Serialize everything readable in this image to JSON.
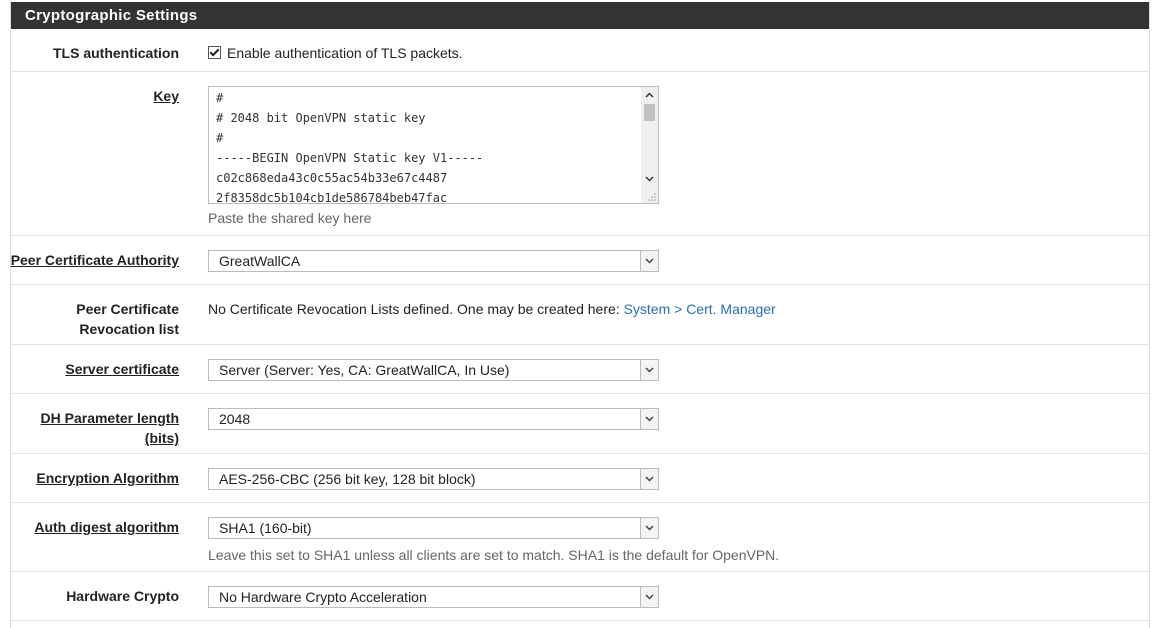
{
  "section": {
    "title": "Cryptographic Settings"
  },
  "tls": {
    "label": "TLS authentication",
    "checkbox_label": "Enable authentication of TLS packets.",
    "checked": true
  },
  "key": {
    "label": "Key",
    "lines": [
      "#",
      "# 2048 bit OpenVPN static key",
      "#",
      "-----BEGIN OpenVPN Static key V1-----",
      "c02c868eda43c0c55ac54b33e67c4487",
      "2f8358dc5b104cb1de586784beb47fac"
    ],
    "help": "Paste the shared key here"
  },
  "peer_ca": {
    "label": "Peer Certificate Authority",
    "value": "GreatWallCA"
  },
  "peer_crl": {
    "label_line1": "Peer Certificate",
    "label_line2": "Revocation list",
    "text": "No Certificate Revocation Lists defined. One may be created here:",
    "link": "System > Cert. Manager"
  },
  "server_cert": {
    "label": "Server certificate",
    "value": "Server (Server: Yes, CA: GreatWallCA, In Use)"
  },
  "dh": {
    "label_line1": "DH Parameter length",
    "label_line2": "(bits)",
    "value": "2048"
  },
  "encryption": {
    "label": "Encryption Algorithm",
    "value": "AES-256-CBC (256 bit key, 128 bit block)"
  },
  "auth_digest": {
    "label": "Auth digest algorithm",
    "value": "SHA1 (160-bit)",
    "help": "Leave this set to SHA1 unless all clients are set to match. SHA1 is the default for OpenVPN."
  },
  "hw_crypto": {
    "label": "Hardware Crypto",
    "value": "No Hardware Crypto Acceleration"
  },
  "icons": {
    "select_arrow": "chevron-down-icon",
    "checkbox": "checkbox-checked-icon"
  }
}
